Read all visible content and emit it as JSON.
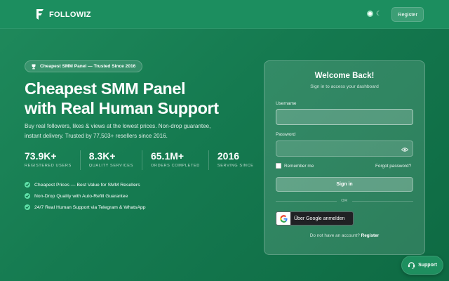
{
  "header": {
    "brand": "FOLLOWIZ",
    "register_label": "Register",
    "theme_icon": "moon-icon"
  },
  "hero": {
    "badge": "Cheapest SMM Panel — Trusted Since 2016",
    "title_line1": "Cheapest SMM Panel",
    "title_line2": "with Real Human Support",
    "description": "Buy real followers, likes & views at the lowest prices. Non-drop guarantee, instant delivery. Trusted by 77,503+ resellers since 2016.",
    "stats": [
      {
        "value": "73.9K+",
        "label": "REGISTERED USERS"
      },
      {
        "value": "8.3K+",
        "label": "QUALITY SERVICES"
      },
      {
        "value": "65.1M+",
        "label": "ORDERS COMPLETED"
      },
      {
        "value": "2016",
        "label": "SERVING SINCE"
      }
    ],
    "features": [
      "Cheapest Prices — Best Value for SMM Resellers",
      "Non-Drop Quality with Auto-Refill Guarantee",
      "24/7 Real Human Support via Telegram & WhatsApp"
    ]
  },
  "login": {
    "title": "Welcome Back!",
    "subtitle": "Sign in to access your dashboard",
    "username_label": "Username",
    "username_value": "",
    "password_label": "Password",
    "password_value": "",
    "remember_label": "Remember me",
    "forgot_label": "Forgot password?",
    "signin_label": "Sign in",
    "or_label": "OR",
    "google_label": "Über Google anmelden",
    "no_account_text": "Do not have an account?",
    "register_link": "Register"
  },
  "support": {
    "label": "Support"
  },
  "colors": {
    "background": "#157a50",
    "accent": "#5fe0a8",
    "google_button": "#202124"
  }
}
